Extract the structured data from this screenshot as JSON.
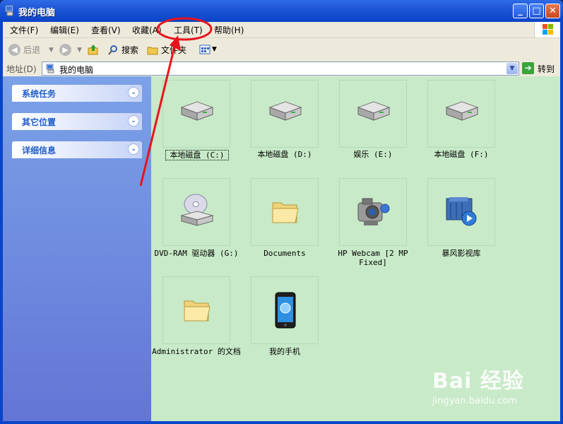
{
  "window": {
    "title": "我的电脑"
  },
  "menu": [
    "文件(F)",
    "编辑(E)",
    "查看(V)",
    "收藏(A)",
    "工具(T)",
    "帮助(H)"
  ],
  "toolbar": {
    "back": "后退",
    "search": "搜索",
    "folders": "文件夹"
  },
  "address": {
    "label": "地址(D)",
    "value": "我的电脑",
    "go": "转到"
  },
  "sidebar": {
    "panels": [
      "系统任务",
      "其它位置",
      "详细信息"
    ]
  },
  "items": [
    {
      "label": "本地磁盘 (C:)",
      "icon": "hard-drive-icon"
    },
    {
      "label": "本地磁盘 (D:)",
      "icon": "hard-drive-icon"
    },
    {
      "label": "娱乐 (E:)",
      "icon": "hard-drive-icon"
    },
    {
      "label": "本地磁盘 (F:)",
      "icon": "hard-drive-icon"
    },
    {
      "label": "DVD-RAM 驱动器 (G:)",
      "icon": "dvd-drive-icon"
    },
    {
      "label": "Documents",
      "icon": "folder-icon"
    },
    {
      "label": "HP Webcam [2 MP Fixed]",
      "icon": "webcam-icon"
    },
    {
      "label": "暴风影视库",
      "icon": "media-library-icon"
    },
    {
      "label": "Administrator 的文档",
      "icon": "folder-icon"
    },
    {
      "label": "我的手机",
      "icon": "phone-icon"
    }
  ],
  "watermark": {
    "main": "Bai 经验",
    "sub": "jingyan.baidu.com"
  },
  "colors": {
    "sidebar": "#6F8BDE",
    "content": "#C8EAC8",
    "annotation": "#E8141B"
  }
}
